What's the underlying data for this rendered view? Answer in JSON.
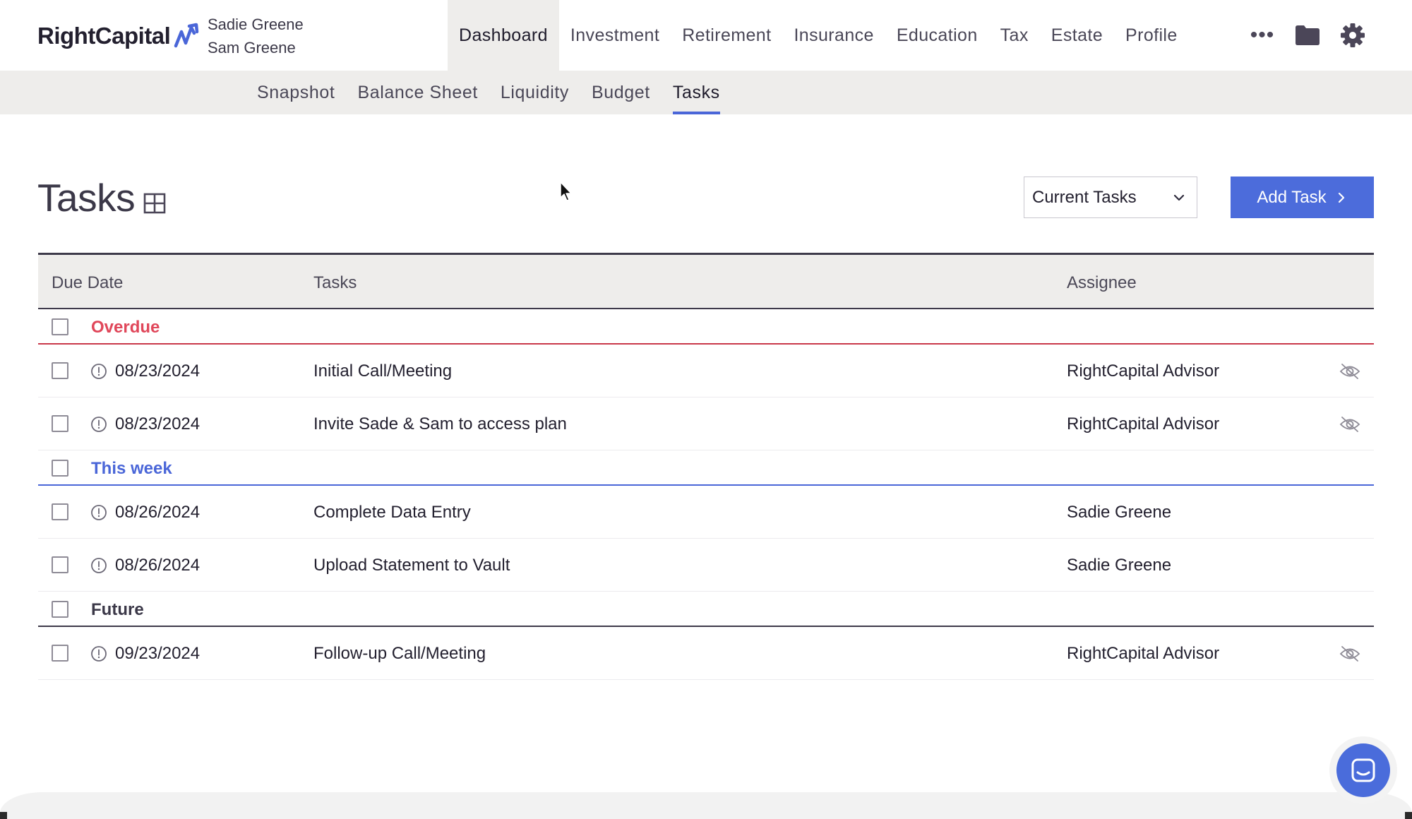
{
  "brand": {
    "name": "RightCapital",
    "accent": "#4c6cdb",
    "overdue_color": "#e0475a"
  },
  "clients": [
    "Sadie Greene",
    "Sam Greene"
  ],
  "main_nav": [
    "Dashboard",
    "Investment",
    "Retirement",
    "Insurance",
    "Education",
    "Tax",
    "Estate",
    "Profile"
  ],
  "main_nav_active": "Dashboard",
  "nav_icons": {
    "more": "•••",
    "folder": "folder-icon",
    "settings": "gear-icon"
  },
  "sub_nav": [
    "Snapshot",
    "Balance Sheet",
    "Liquidity",
    "Budget",
    "Tasks"
  ],
  "sub_nav_active": "Tasks",
  "page": {
    "title": "Tasks",
    "filter_value": "Current Tasks",
    "add_button": "Add Task"
  },
  "table": {
    "headers": {
      "due_date": "Due Date",
      "tasks": "Tasks",
      "assignee": "Assignee"
    },
    "groups": [
      {
        "label": "Overdue",
        "tasks": [
          {
            "due": "08/23/2024",
            "name": "Initial Call/Meeting",
            "assignee": "RightCapital Advisor",
            "hidden_from_client": true
          },
          {
            "due": "08/23/2024",
            "name": "Invite Sade & Sam to access plan",
            "assignee": "RightCapital Advisor",
            "hidden_from_client": true
          }
        ]
      },
      {
        "label": "This week",
        "tasks": [
          {
            "due": "08/26/2024",
            "name": "Complete Data Entry",
            "assignee": "Sadie Greene",
            "hidden_from_client": false
          },
          {
            "due": "08/26/2024",
            "name": "Upload Statement to Vault",
            "assignee": "Sadie Greene",
            "hidden_from_client": false
          }
        ]
      },
      {
        "label": "Future",
        "tasks": [
          {
            "due": "09/23/2024",
            "name": "Follow-up Call/Meeting",
            "assignee": "RightCapital Advisor",
            "hidden_from_client": true
          }
        ]
      }
    ]
  }
}
